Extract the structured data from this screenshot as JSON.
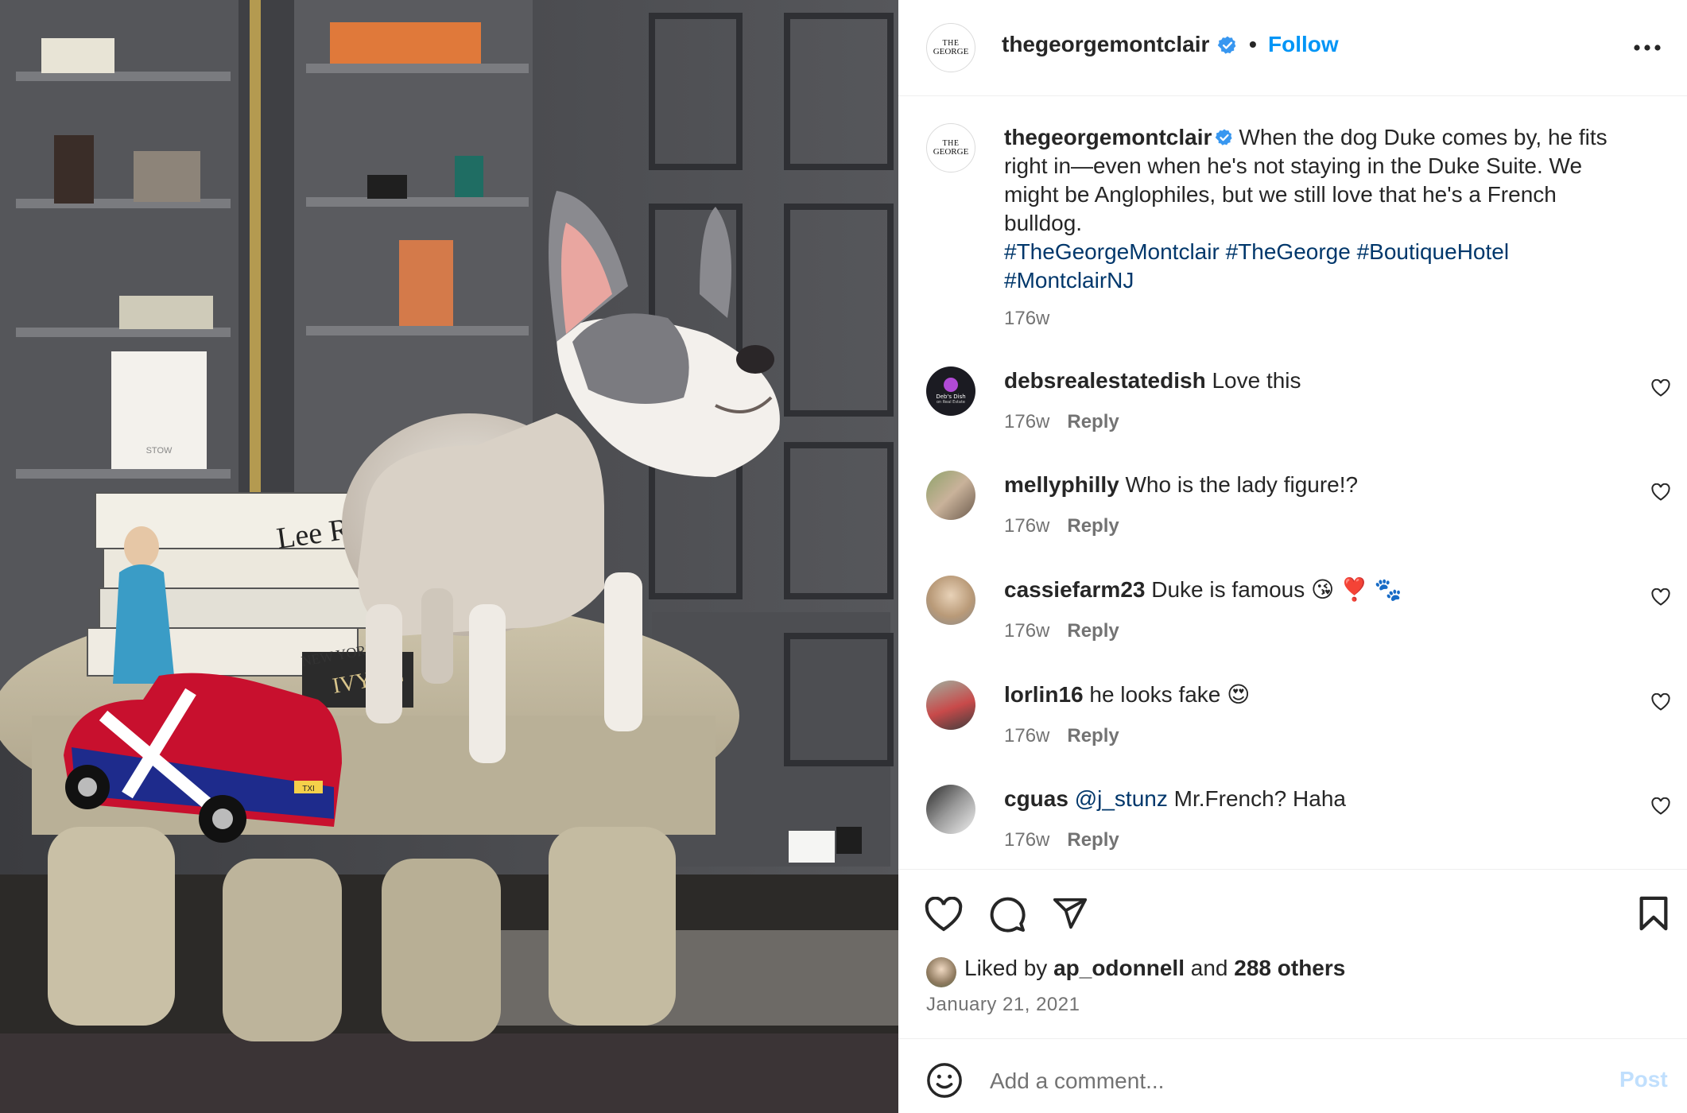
{
  "photo": {
    "alt_subject": "French bulldog puppy on table",
    "book_spine_text": "Lee Radz",
    "book_spine_text_2": "NEW YORK",
    "book_spine_text_3": "IVY LE",
    "shelf_box_text": "STOW",
    "taxi_plate": "TXI"
  },
  "post": {
    "account": {
      "username": "thegeorgemontclair",
      "logo_line1": "THE",
      "logo_line2": "GEORGE",
      "verified_icon": "verified-badge-icon"
    },
    "header": {
      "separator": "•",
      "follow_label": "Follow",
      "more_icon": "more-horizontal-icon"
    },
    "caption": {
      "text": "When the dog Duke comes by, he fits right in—even when he's not staying in the Duke Suite. We might be Anglophiles, but we still love that he's a French bulldog.",
      "hashtags": [
        "#TheGeorgeMontclair",
        "#TheGeorge",
        "#BoutiqueHotel",
        "#MontclairNJ"
      ],
      "age": "176w"
    },
    "comments": [
      {
        "username": "debsrealestatedish",
        "text": "Love this",
        "age": "176w",
        "reply_label": "Reply",
        "avatar_text_1": "Deb's Dish",
        "avatar_text_2": "on Real Estate"
      },
      {
        "username": "mellyphilly",
        "text": "Who is the lady figure!?",
        "age": "176w",
        "reply_label": "Reply"
      },
      {
        "username": "cassiefarm23",
        "text": "Duke is famous 😘 ❣️ 🐾",
        "age": "176w",
        "reply_label": "Reply"
      },
      {
        "username": "lorlin16",
        "text": "he looks fake 😍",
        "age": "176w",
        "reply_label": "Reply"
      },
      {
        "username": "cguas",
        "mention": "@j_stunz",
        "text": "Mr.French? Haha",
        "age": "176w",
        "reply_label": "Reply"
      }
    ],
    "actions": {
      "like_icon": "heart-icon",
      "comment_icon": "comment-icon",
      "share_icon": "send-icon",
      "save_icon": "bookmark-icon"
    },
    "likes": {
      "prefix": "Liked by",
      "user": "ap_odonnell",
      "conjunction": "and",
      "others": "288 others"
    },
    "date": "January 21, 2021",
    "comment_box": {
      "placeholder": "Add a comment...",
      "post_label": "Post",
      "emoji_icon": "emoji-smile-icon"
    }
  },
  "colors": {
    "link_blue": "#0095f6",
    "hashtag_blue": "#00376b",
    "muted_text": "#737373",
    "post_disabled": "#c0dffd",
    "verified_blue": "#3897f0"
  }
}
